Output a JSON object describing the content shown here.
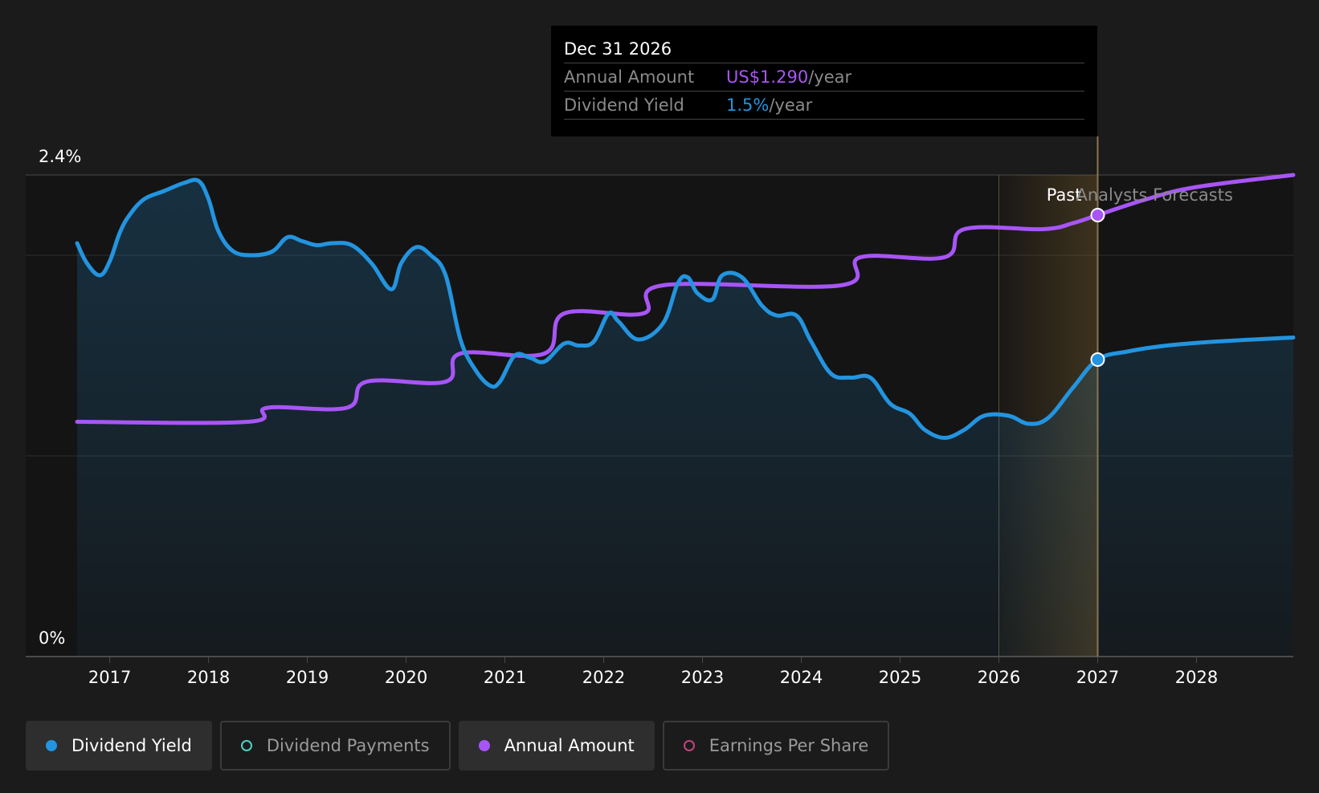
{
  "colors": {
    "yield": "#2394df",
    "annual": "#a855f7",
    "payments": "#4fd1c5",
    "eps": "#c2457f",
    "forecast_band": "#8a6a30"
  },
  "tooltip": {
    "date": "Dec 31 2026",
    "rows": [
      {
        "label": "Annual Amount",
        "value": "US$1.290",
        "unit": "/year",
        "color": "#a855f7"
      },
      {
        "label": "Dividend Yield",
        "value": "1.5%",
        "unit": "/year",
        "color": "#2394df"
      }
    ]
  },
  "labels": {
    "past": "Past",
    "forecast": "Analysts Forecasts"
  },
  "legend": [
    {
      "name": "Dividend Yield",
      "color": "#2394df",
      "active": true,
      "filled": true
    },
    {
      "name": "Dividend Payments",
      "color": "#4fd1c5",
      "active": false,
      "filled": false
    },
    {
      "name": "Annual Amount",
      "color": "#a855f7",
      "active": true,
      "filled": true
    },
    {
      "name": "Earnings Per Share",
      "color": "#c2457f",
      "active": false,
      "filled": false
    }
  ],
  "chart_data": {
    "type": "line",
    "title": "",
    "xlabel": "",
    "ylabel": "",
    "x_ticks": [
      "2017",
      "2018",
      "2019",
      "2020",
      "2021",
      "2022",
      "2023",
      "2024",
      "2025",
      "2026",
      "2027",
      "2028"
    ],
    "y_tick_labels": [
      "2.4%",
      "0%"
    ],
    "x_range": [
      2016.67,
      2028.98
    ],
    "ylim": [
      0,
      2.4
    ],
    "grid": true,
    "past_start": 2026.0,
    "forecast_start": 2027.0,
    "highlight_x": 2027.0,
    "series": [
      {
        "name": "Dividend Yield",
        "color": "#2394df",
        "area": true,
        "points": [
          [
            2016.67,
            2.06
          ],
          [
            2016.77,
            1.96
          ],
          [
            2016.9,
            1.9
          ],
          [
            2017.0,
            1.97
          ],
          [
            2017.1,
            2.11
          ],
          [
            2017.2,
            2.2
          ],
          [
            2017.35,
            2.28
          ],
          [
            2017.55,
            2.32
          ],
          [
            2017.75,
            2.36
          ],
          [
            2017.9,
            2.37
          ],
          [
            2018.0,
            2.28
          ],
          [
            2018.1,
            2.12
          ],
          [
            2018.25,
            2.02
          ],
          [
            2018.45,
            2.0
          ],
          [
            2018.65,
            2.02
          ],
          [
            2018.8,
            2.09
          ],
          [
            2018.95,
            2.07
          ],
          [
            2019.1,
            2.05
          ],
          [
            2019.25,
            2.06
          ],
          [
            2019.45,
            2.05
          ],
          [
            2019.65,
            1.96
          ],
          [
            2019.85,
            1.83
          ],
          [
            2019.95,
            1.96
          ],
          [
            2020.1,
            2.04
          ],
          [
            2020.25,
            2.0
          ],
          [
            2020.4,
            1.9
          ],
          [
            2020.55,
            1.58
          ],
          [
            2020.7,
            1.43
          ],
          [
            2020.85,
            1.35
          ],
          [
            2020.95,
            1.37
          ],
          [
            2021.1,
            1.5
          ],
          [
            2021.25,
            1.49
          ],
          [
            2021.4,
            1.47
          ],
          [
            2021.6,
            1.56
          ],
          [
            2021.75,
            1.55
          ],
          [
            2021.9,
            1.57
          ],
          [
            2022.05,
            1.71
          ],
          [
            2022.15,
            1.67
          ],
          [
            2022.35,
            1.58
          ],
          [
            2022.6,
            1.66
          ],
          [
            2022.75,
            1.86
          ],
          [
            2022.85,
            1.89
          ],
          [
            2022.95,
            1.81
          ],
          [
            2023.1,
            1.78
          ],
          [
            2023.2,
            1.9
          ],
          [
            2023.4,
            1.89
          ],
          [
            2023.6,
            1.75
          ],
          [
            2023.75,
            1.7
          ],
          [
            2023.95,
            1.7
          ],
          [
            2024.1,
            1.57
          ],
          [
            2024.3,
            1.41
          ],
          [
            2024.5,
            1.39
          ],
          [
            2024.7,
            1.39
          ],
          [
            2024.9,
            1.26
          ],
          [
            2025.1,
            1.21
          ],
          [
            2025.25,
            1.13
          ],
          [
            2025.45,
            1.09
          ],
          [
            2025.65,
            1.13
          ],
          [
            2025.85,
            1.2
          ],
          [
            2026.1,
            1.2
          ],
          [
            2026.3,
            1.16
          ],
          [
            2026.5,
            1.19
          ],
          [
            2026.75,
            1.34
          ],
          [
            2027.0,
            1.48
          ],
          [
            2027.3,
            1.52
          ],
          [
            2027.7,
            1.55
          ],
          [
            2028.2,
            1.57
          ],
          [
            2028.98,
            1.59
          ]
        ]
      },
      {
        "name": "Annual Amount",
        "color": "#a855f7",
        "area": false,
        "points": [
          [
            2016.67,
            1.17
          ],
          [
            2018.4,
            1.17
          ],
          [
            2018.6,
            1.24
          ],
          [
            2019.4,
            1.24
          ],
          [
            2019.6,
            1.37
          ],
          [
            2020.4,
            1.37
          ],
          [
            2020.55,
            1.51
          ],
          [
            2021.4,
            1.51
          ],
          [
            2021.6,
            1.71
          ],
          [
            2022.4,
            1.71
          ],
          [
            2022.6,
            1.85
          ],
          [
            2024.4,
            1.85
          ],
          [
            2024.6,
            1.99
          ],
          [
            2025.45,
            1.99
          ],
          [
            2025.65,
            2.13
          ],
          [
            2026.45,
            2.13
          ],
          [
            2026.75,
            2.16
          ],
          [
            2027.0,
            2.2
          ],
          [
            2027.5,
            2.28
          ],
          [
            2028.0,
            2.34
          ],
          [
            2028.98,
            2.4
          ]
        ]
      }
    ]
  }
}
